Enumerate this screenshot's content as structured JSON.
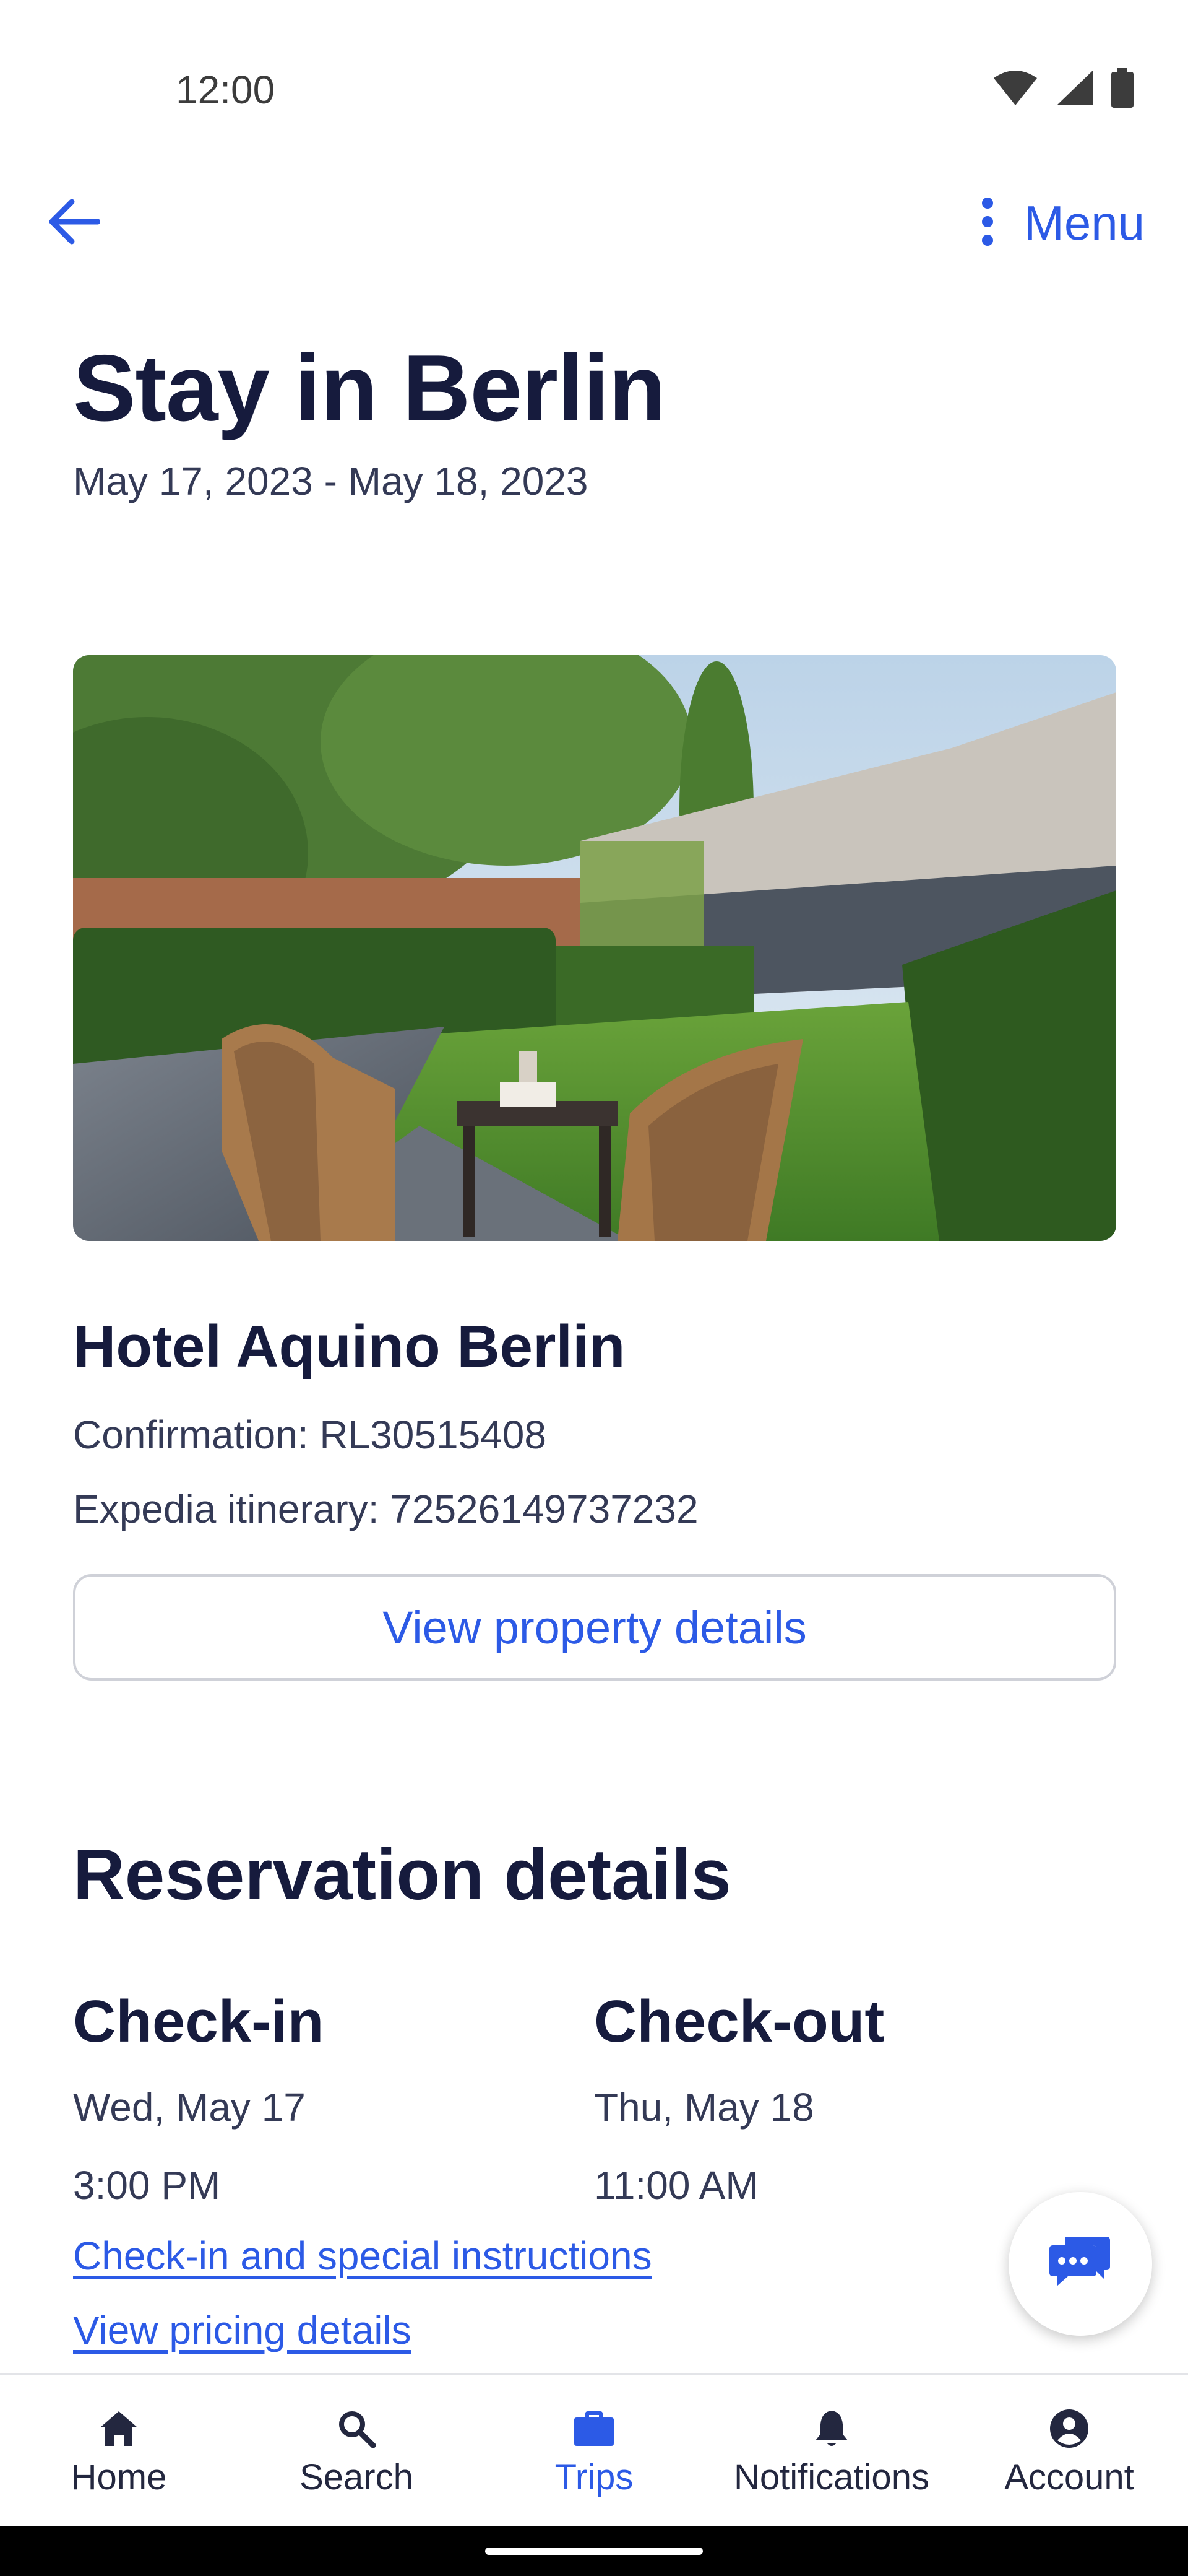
{
  "status_bar": {
    "time": "12:00"
  },
  "app_bar": {
    "menu_label": "Menu"
  },
  "page": {
    "title": "Stay in Berlin",
    "dates": "May 17, 2023 - May 18, 2023"
  },
  "hotel": {
    "name": "Hotel Aquino Berlin",
    "confirmation": "Confirmation: RL30515408",
    "itinerary": "Expedia itinerary: 72526149737232",
    "view_details_label": "View property details"
  },
  "reservation": {
    "title": "Reservation details",
    "check_in": {
      "label": "Check-in",
      "day": "Wed, May 17",
      "time": "3:00 PM"
    },
    "check_out": {
      "label": "Check-out",
      "day": "Thu, May 18",
      "time": "11:00 AM"
    },
    "links": {
      "instructions": "Check-in and special instructions",
      "pricing": "View pricing details"
    }
  },
  "bottom_nav": {
    "items": [
      {
        "label": "Home",
        "icon": "home-icon"
      },
      {
        "label": "Search",
        "icon": "search-icon"
      },
      {
        "label": "Trips",
        "icon": "briefcase-icon",
        "active": true
      },
      {
        "label": "Notifications",
        "icon": "bell-icon"
      },
      {
        "label": "Account",
        "icon": "account-icon"
      }
    ]
  },
  "colors": {
    "accent": "#2c5ae6",
    "heading": "#161b3d",
    "body": "#343a56",
    "border": "#cfd1d8"
  }
}
